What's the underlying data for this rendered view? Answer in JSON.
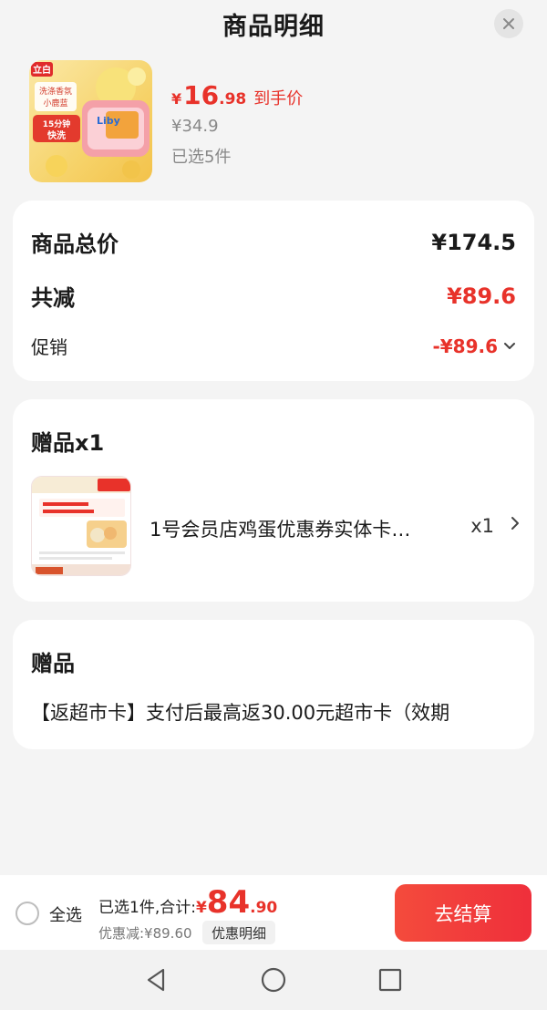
{
  "header": {
    "title": "商品明细"
  },
  "product": {
    "price_currency": "¥",
    "price_integer": "16",
    "price_decimal": ".98",
    "price_tag": "到手价",
    "original_price": "¥34.9",
    "selected_count": "已选5件",
    "thumb_brand": "立白",
    "thumb_line1": "洗涤香氛",
    "thumb_line2": "小鹿蓝",
    "thumb_badge_1": "15分钟",
    "thumb_badge_2": "快洗",
    "thumb_logo": "Liby"
  },
  "summary": {
    "total_label": "商品总价",
    "total_value": "¥174.5",
    "reduce_label": "共减",
    "reduce_value": "¥89.6",
    "promo_label": "促销",
    "promo_value": "-¥89.6"
  },
  "gift": {
    "title": "赠品x1",
    "item_name": "1号会员店鸡蛋优惠券实体卡…",
    "item_qty": "x1"
  },
  "promo": {
    "title": "赠品",
    "text": "【返超市卡】支付后最高返30.00元超市卡（效期"
  },
  "bottom": {
    "select_all": "全选",
    "total_prefix": "已选1件,合计:",
    "total_currency": "¥",
    "total_integer": "84",
    "total_decimal": ".90",
    "discount": "优惠减:¥89.60",
    "discount_detail": "优惠明细",
    "checkout": "去结算"
  },
  "colors": {
    "accent": "#e8322a",
    "background": "#f4f4f4"
  }
}
